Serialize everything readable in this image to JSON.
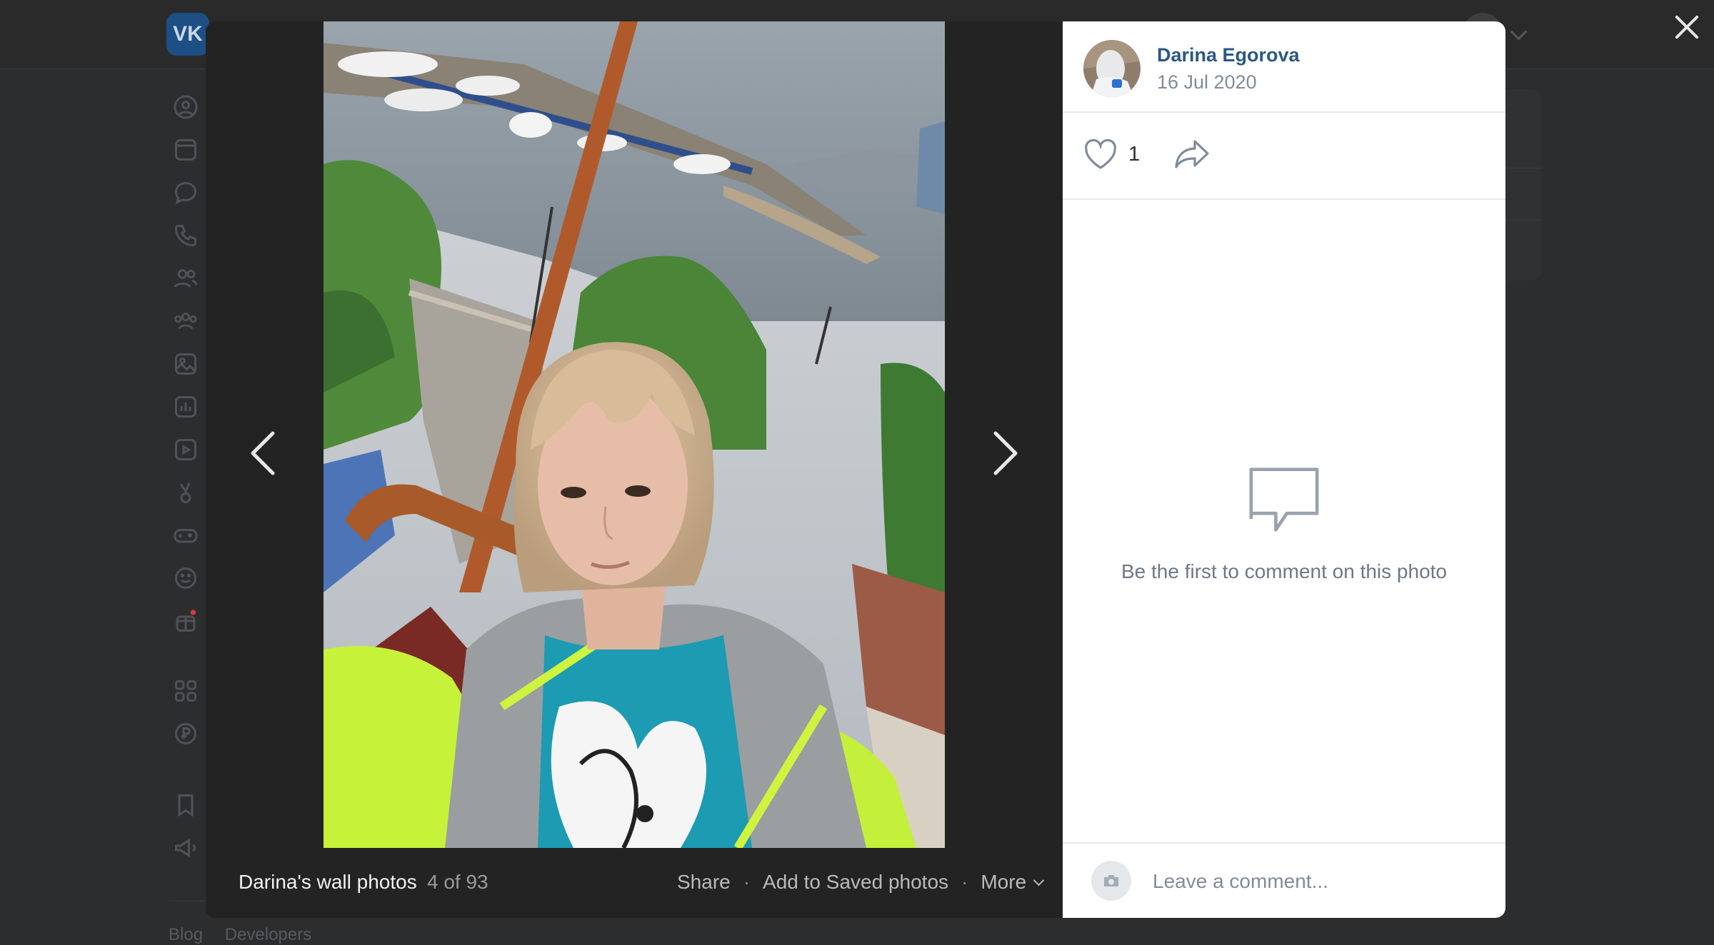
{
  "background": {
    "logo_text": "VK",
    "footer_links": [
      "Blog",
      "Developers"
    ],
    "sidebar_icons": [
      "profile-icon",
      "news-icon",
      "messenger-icon",
      "calls-icon",
      "friends-icon",
      "communities-icon",
      "photos-icon",
      "music-icon",
      "videos-icon",
      "clips-icon",
      "games-icon",
      "stickers-icon",
      "gifts-icon",
      "services-icon",
      "vk-pay-icon",
      "bookmarks-icon",
      "ads-icon"
    ]
  },
  "viewer": {
    "album_title": "Darina's wall photos",
    "counter": "4 of 93",
    "actions": {
      "share": "Share",
      "save": "Add to Saved photos",
      "more": "More"
    }
  },
  "panel": {
    "author_name": "Darina Egorova",
    "date": "16 Jul 2020",
    "likes": "1",
    "empty_comments": "Be the first to comment on this photo",
    "comment_placeholder": "Leave a comment..."
  },
  "colors": {
    "link": "#2a5885",
    "muted": "#818c99",
    "overlay": "#1f1f1f"
  }
}
